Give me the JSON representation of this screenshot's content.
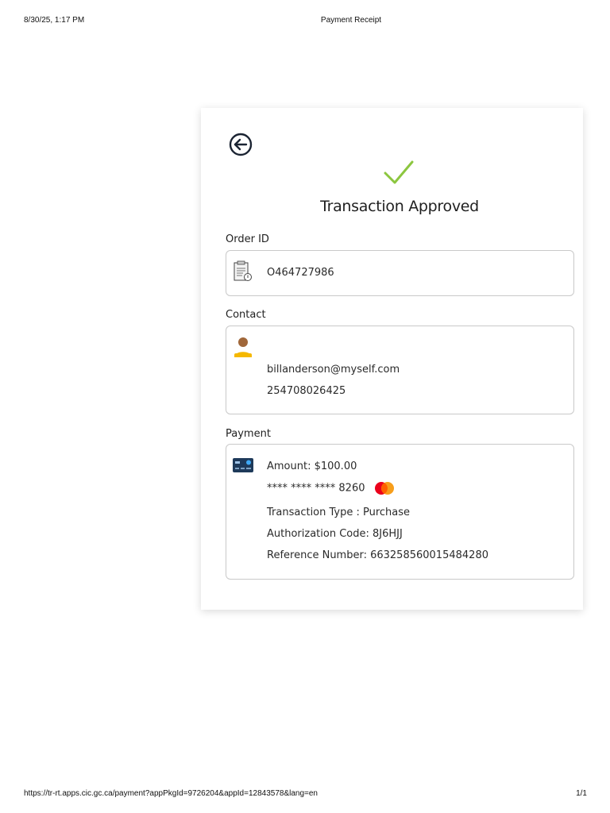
{
  "print": {
    "datetime": "8/30/25, 1:17 PM",
    "page_title": "Payment Receipt",
    "url": "https://tr-rt.apps.cic.gc.ca/payment?appPkgId=9726204&appId=12843578&lang=en",
    "page_count": "1/1"
  },
  "receipt": {
    "status_title": "Transaction Approved",
    "order": {
      "label": "Order ID",
      "value": "O464727986"
    },
    "contact": {
      "label": "Contact",
      "email": "billanderson@myself.com",
      "phone": "254708026425"
    },
    "payment": {
      "label": "Payment",
      "amount": "Amount: $100.00",
      "card_masked": "**** **** **** 8260",
      "transaction_type": "Transaction Type : Purchase",
      "authorization_code": "Authorization Code: 8J6HJJ",
      "reference_number": "Reference Number: 663258560015484280"
    }
  },
  "icons": {
    "back": "circle-arrow-left-icon",
    "check": "checkmark-icon",
    "order": "clipboard-icon",
    "contact": "person-icon",
    "payment": "credit-card-icon",
    "card_brand": "mastercard-icon"
  },
  "colors": {
    "check": "#8cc63f",
    "person_head": "#a0673a",
    "person_body": "#f5b800",
    "card": "#1e3a5a",
    "mastercard_red": "#eb001b",
    "mastercard_orange": "#f79e1b"
  }
}
